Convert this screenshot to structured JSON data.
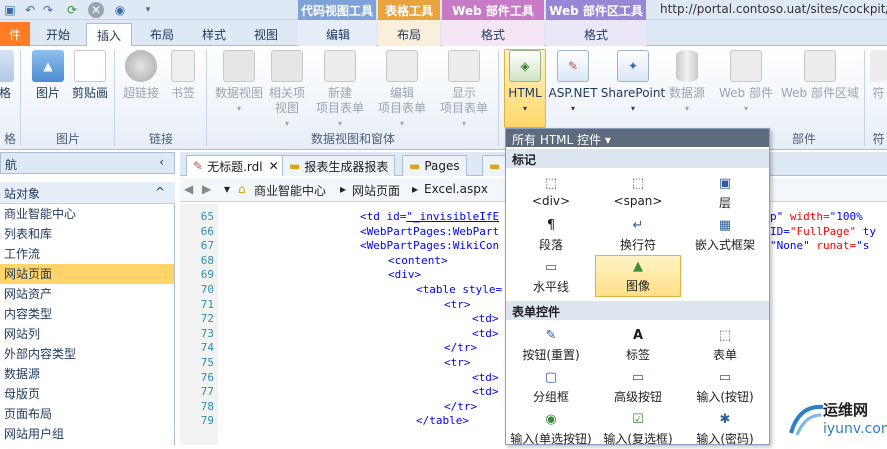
{
  "qat": {
    "icons": [
      "save-icon",
      "undo-icon",
      "redo-icon",
      "refresh-icon",
      "stop-icon",
      "preview-icon",
      "customize-icon"
    ]
  },
  "context_tabs": [
    {
      "label": "代码视图工具",
      "color": "#7fa2d8"
    },
    {
      "label": "表格工具",
      "color": "#e8a33c"
    },
    {
      "label": "Web 部件工具",
      "color": "#c87ac6"
    },
    {
      "label": "Web 部件区工具",
      "color": "#9a86d6"
    }
  ],
  "url": "http://portal.contoso.uat/sites/cockpit/S",
  "tabs": [
    {
      "label": "件",
      "type": "file"
    },
    {
      "label": "开始"
    },
    {
      "label": "插入",
      "active": true
    },
    {
      "label": "布局"
    },
    {
      "label": "样式"
    },
    {
      "label": "视图"
    },
    {
      "label": "编辑"
    },
    {
      "label": "布局"
    },
    {
      "label": "格式"
    },
    {
      "label": "格式"
    }
  ],
  "ribbon": {
    "buttons": [
      {
        "label": "格",
        "icon": "table-icon",
        "disabled": false
      },
      {
        "label": "图片",
        "icon": "picture-icon",
        "disabled": false
      },
      {
        "label": "剪贴画",
        "icon": "clipart-icon",
        "disabled": false
      },
      {
        "label": "超链接",
        "icon": "hyperlink-icon",
        "disabled": true
      },
      {
        "label": "书签",
        "icon": "bookmark-icon",
        "disabled": true
      },
      {
        "label": "数据视图",
        "dd": "▾",
        "icon": "dataview-icon",
        "disabled": true
      },
      {
        "label": "相关项",
        "label2": "视图",
        "dd": "▾",
        "icon": "related-icon",
        "disabled": true
      },
      {
        "label": "新建",
        "label2": "项目表单",
        "dd": "▾",
        "icon": "new-form-icon",
        "disabled": true
      },
      {
        "label": "编辑",
        "label2": "项目表单",
        "dd": "▾",
        "icon": "edit-form-icon",
        "disabled": true
      },
      {
        "label": "显示",
        "label2": "项目表单",
        "dd": "▾",
        "icon": "display-form-icon",
        "disabled": true
      },
      {
        "label": "HTML",
        "dd": "▾",
        "icon": "html-icon",
        "disabled": false
      },
      {
        "label": "ASP.NET",
        "dd": "▾",
        "icon": "aspnet-icon",
        "disabled": false
      },
      {
        "label": "SharePoint",
        "dd": "▾",
        "icon": "sharepoint-icon",
        "disabled": false
      },
      {
        "label": "数据源",
        "dd": "▾",
        "icon": "datasource-icon",
        "disabled": true
      },
      {
        "label": "Web 部件",
        "dd": "▾",
        "icon": "webpart-icon",
        "disabled": true
      },
      {
        "label": "Web 部件区域",
        "icon": "webpart-zone-icon",
        "disabled": true
      },
      {
        "label": "符",
        "icon": "symbol-icon",
        "disabled": true
      }
    ],
    "groups": [
      "格",
      "图片",
      "链接",
      "数据视图和窗体",
      "部件",
      "符"
    ]
  },
  "nav": {
    "header": "航",
    "collapse": "‹",
    "sub": "站对象",
    "sub_toggle": "^",
    "items": [
      "商业智能中心",
      "列表和库",
      "工作流",
      "网站页面",
      "网站资产",
      "内容类型",
      "网站列",
      "外部内容类型",
      "数据源",
      "母版页",
      "页面布局",
      "网站用户组"
    ],
    "selected_index": 3
  },
  "doctabs": [
    "无标题.rdl",
    "报表生成器报表",
    "Pages",
    "Ex"
  ],
  "breadcrumb": [
    "商业智能中心",
    "网站页面",
    "Excel.aspx"
  ],
  "code": {
    "lines": [
      {
        "n": "65",
        "parts": [
          {
            "t": "<td id=",
            "c": "tag"
          },
          {
            "t": "\"_invisibleIfE",
            "c": "val"
          }
        ]
      },
      {
        "n": "66",
        "parts": [
          {
            "t": "<WebPartPages:WebPart",
            "c": "tag"
          }
        ]
      },
      {
        "n": "67",
        "parts": [
          {
            "t": "<WebPartPages:WikiCon",
            "c": "tag"
          }
        ]
      },
      {
        "n": "68",
        "parts": [
          {
            "t": "<content>",
            "c": "tag"
          }
        ]
      },
      {
        "n": "69",
        "parts": [
          {
            "t": "<div>",
            "c": "tag"
          }
        ]
      },
      {
        "n": "70",
        "parts": [
          {
            "t": "<table style=",
            "c": "tag"
          }
        ]
      },
      {
        "n": "71",
        "parts": [
          {
            "t": "<tr>",
            "c": "tag"
          }
        ]
      },
      {
        "n": "72",
        "parts": [
          {
            "t": "<td>",
            "c": "tag"
          }
        ]
      },
      {
        "n": "73",
        "parts": [
          {
            "t": "<td>",
            "c": "tag"
          }
        ]
      },
      {
        "n": "74",
        "parts": [
          {
            "t": "</tr>",
            "c": "tag"
          }
        ]
      },
      {
        "n": "75",
        "parts": [
          {
            "t": "<tr>",
            "c": "tag"
          }
        ]
      },
      {
        "n": "76",
        "parts": [
          {
            "t": "<td>",
            "c": "tag"
          }
        ]
      },
      {
        "n": "77",
        "parts": [
          {
            "t": "<td>",
            "c": "tag"
          }
        ]
      },
      {
        "n": "78",
        "parts": [
          {
            "t": "</tr>",
            "c": "tag"
          }
        ]
      },
      {
        "n": "79",
        "parts": [
          {
            "t": "</table>",
            "c": "tag"
          }
        ]
      }
    ],
    "right_fragments": [
      {
        "line": "65",
        "a": "p\" ",
        "b": "width=",
        "c": "\"100%"
      },
      {
        "line": "66",
        "a": " ID=",
        "b": "\"FullPage\"",
        "c": " ty"
      },
      {
        "line": "67",
        "a": "\"None\" ",
        "b": "runat=",
        "c": "\"s"
      }
    ]
  },
  "panel": {
    "header": "所有 HTML 控件 ▾",
    "sections": [
      {
        "title": "标记",
        "items": [
          {
            "label": "<div>",
            "icon": "div-icon"
          },
          {
            "label": "<span>",
            "icon": "span-icon"
          },
          {
            "label": "层",
            "icon": "layer-icon"
          },
          {
            "label": "段落",
            "icon": "paragraph-icon"
          },
          {
            "label": "换行符",
            "icon": "line-break-icon"
          },
          {
            "label": "嵌入式框架",
            "icon": "iframe-icon"
          },
          {
            "label": "水平线",
            "icon": "horizontal-line-icon"
          },
          {
            "label": "图像",
            "icon": "image-icon",
            "selected": true
          }
        ]
      },
      {
        "title": "表单控件",
        "items": [
          {
            "label": "按钮(重置)",
            "icon": "reset-button-icon"
          },
          {
            "label": "标签",
            "icon": "label-icon"
          },
          {
            "label": "表单",
            "icon": "form-icon"
          },
          {
            "label": "分组框",
            "icon": "groupbox-icon"
          },
          {
            "label": "高级按钮",
            "icon": "advanced-button-icon"
          },
          {
            "label": "输入(按钮)",
            "icon": "input-button-icon"
          },
          {
            "label": "输入(单选按钮)",
            "icon": "radio-icon"
          },
          {
            "label": "输入(复选框)",
            "icon": "checkbox-icon"
          },
          {
            "label": "输入(密码)",
            "icon": "password-icon"
          }
        ]
      }
    ]
  },
  "watermark": {
    "title": "运维网",
    "url": "iyunv.com"
  }
}
